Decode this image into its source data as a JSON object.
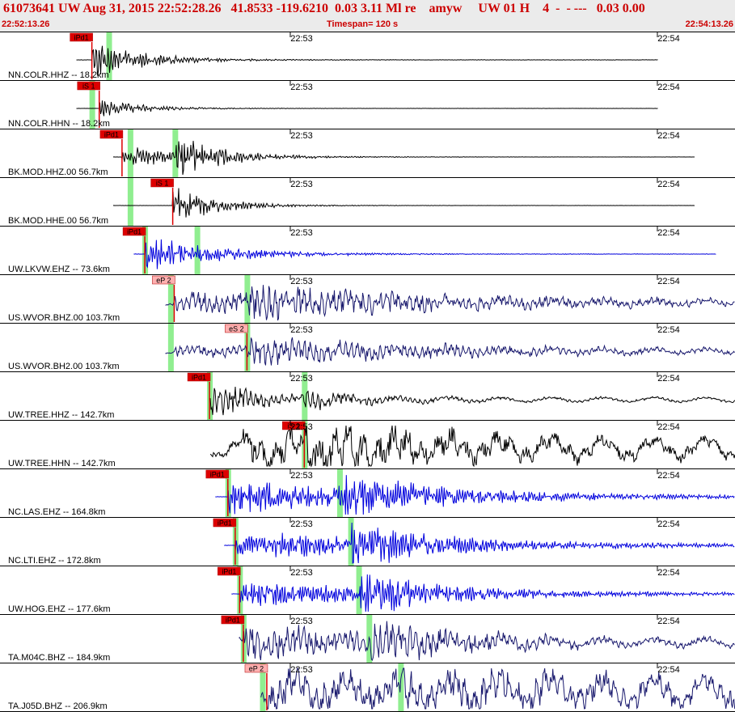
{
  "header": {
    "title": "61073641 UW Aug 31, 2015 22:52:28.26   41.8533 -119.6210  0.03 3.11 Ml re    amyw     UW 01 H    4  -  - ---   0.03 0.00",
    "start_time": "22:52:13.26",
    "timespan": "Timespan= 120 s",
    "end_time": "22:54:13.26"
  },
  "time_ticks": [
    "22:53",
    "22:54"
  ],
  "colors": {
    "black_trace": "#000000",
    "blue_trace": "#0000dd",
    "navy_trace": "#1a1a6e",
    "pick_red": "#dd0000",
    "pick_pale": "#ffb0b0",
    "green_window": "#90ee90"
  },
  "traces": [
    {
      "label": "NN.COLR.HHZ -- 18.2km",
      "color": "black",
      "start": 0.104,
      "end": 0.896,
      "onset": 0.125,
      "amp": 1.0,
      "decay": 0.07,
      "noise": 0.01,
      "period": 0.004,
      "second": null,
      "phase": "P",
      "pick": "iPd1",
      "pick_pos": 0.125,
      "green": [
        0.148
      ]
    },
    {
      "label": "NN.COLR.HHN -- 18.2km",
      "color": "black",
      "start": 0.104,
      "end": 0.896,
      "onset": 0.135,
      "amp": 0.5,
      "decay": 0.06,
      "noise": 0.005,
      "period": 0.004,
      "second": null,
      "phase": "S",
      "pick": "iS 1",
      "pick_pos": 0.135,
      "green": [
        0.125
      ]
    },
    {
      "label": "BK.MOD.HHZ.00 56.7km",
      "color": "black",
      "start": 0.154,
      "end": 0.946,
      "onset": 0.166,
      "amp": 0.55,
      "decay": 0.1,
      "noise": 0.005,
      "period": 0.004,
      "second": {
        "at": 0.238,
        "amp": 1.0,
        "decay": 0.05
      },
      "phase": "P",
      "pick": "iPd1",
      "pick_pos": 0.166,
      "green": [
        0.177,
        0.238
      ]
    },
    {
      "label": "BK.MOD.HHE.00 56.7km",
      "color": "black",
      "start": 0.154,
      "end": 0.946,
      "onset": 0.235,
      "amp": 1.0,
      "decay": 0.06,
      "noise": 0.005,
      "period": 0.004,
      "second": null,
      "phase": "S",
      "pick": "iS 1",
      "pick_pos": 0.235,
      "green": [
        0.177
      ]
    },
    {
      "label": "UW.LKVW.EHZ -- 73.6km",
      "color": "blue",
      "start": 0.182,
      "end": 0.975,
      "onset": 0.197,
      "amp": 1.0,
      "decay": 0.1,
      "noise": 0.01,
      "period": 0.0035,
      "second": null,
      "phase": "P",
      "pick": "iPd1",
      "pick_pos": 0.197,
      "green": [
        0.197,
        0.268
      ]
    },
    {
      "label": "US.WVOR.BHZ.00 103.7km",
      "color": "navy",
      "start": 0.225,
      "end": 1.0,
      "onset": 0.237,
      "amp": 0.55,
      "decay": 0.35,
      "noise": 0.06,
      "period": 0.008,
      "second": {
        "at": 0.336,
        "amp": 0.55,
        "decay": 0.25
      },
      "phase": "P",
      "pick": "eP 2",
      "pick_pos": 0.237,
      "green": [
        0.232,
        0.336
      ]
    },
    {
      "label": "US.WVOR.BH2.00 103.7km",
      "color": "navy",
      "start": 0.225,
      "end": 1.0,
      "onset": 0.237,
      "amp": 0.25,
      "decay": 0.3,
      "noise": 0.06,
      "period": 0.008,
      "second": {
        "at": 0.336,
        "amp": 0.55,
        "decay": 0.25
      },
      "phase": "S",
      "pick": "eS 2",
      "pick_pos": 0.336,
      "green": [
        0.232,
        0.336
      ]
    },
    {
      "label": "UW.TREE.HHZ -- 142.7km",
      "color": "black",
      "start": 0.286,
      "end": 1.0,
      "onset": 0.285,
      "amp": 0.9,
      "decay": 0.07,
      "noise": 0.06,
      "period": 0.007,
      "second": {
        "at": 0.414,
        "amp": 0.3,
        "decay": 0.1
      },
      "phase": "P",
      "pick": "iPd1",
      "pick_pos": 0.285,
      "green": [
        0.285,
        0.414
      ]
    },
    {
      "label": "UW.TREE.HHN -- 142.7km",
      "color": "black",
      "start": 0.286,
      "end": 1.0,
      "onset": 0.33,
      "amp": 0.7,
      "decay": 0.3,
      "noise": 0.25,
      "period": 0.02,
      "second": {
        "at": 0.414,
        "amp": 1.0,
        "decay": 0.12
      },
      "phase": "S",
      "pick": "iS 1",
      "pick_pos": 0.414,
      "green": [
        0.414
      ]
    },
    {
      "label": "NC.LAS.EHZ -- 164.8km",
      "color": "blue",
      "start": 0.293,
      "end": 1.0,
      "onset": 0.31,
      "amp": 0.9,
      "decay": 0.3,
      "noise": 0.01,
      "period": 0.0035,
      "second": {
        "at": 0.462,
        "amp": 1.0,
        "decay": 0.08
      },
      "phase": "P",
      "pick": "iPd1",
      "pick_pos": 0.31,
      "green": [
        0.31,
        0.462
      ]
    },
    {
      "label": "NC.LTI.EHZ -- 172.8km",
      "color": "blue",
      "start": 0.305,
      "end": 1.0,
      "onset": 0.32,
      "amp": 0.75,
      "decay": 0.3,
      "noise": 0.01,
      "period": 0.0035,
      "second": {
        "at": 0.477,
        "amp": 0.8,
        "decay": 0.1
      },
      "phase": "P",
      "pick": "iPd1",
      "pick_pos": 0.32,
      "green": [
        0.32,
        0.477
      ]
    },
    {
      "label": "UW.HOG.EHZ -- 177.6km",
      "color": "blue",
      "start": 0.315,
      "end": 1.0,
      "onset": 0.326,
      "amp": 0.65,
      "decay": 0.3,
      "noise": 0.01,
      "period": 0.0035,
      "second": {
        "at": 0.488,
        "amp": 1.0,
        "decay": 0.08
      },
      "phase": "P",
      "pick": "iPd1",
      "pick_pos": 0.326,
      "green": [
        0.326,
        0.488
      ]
    },
    {
      "label": "TA.M04C.BHZ -- 184.9km",
      "color": "navy",
      "start": 0.325,
      "end": 1.0,
      "onset": 0.331,
      "amp": 0.9,
      "decay": 0.2,
      "noise": 0.1,
      "period": 0.008,
      "second": {
        "at": 0.502,
        "amp": 0.7,
        "decay": 0.12
      },
      "phase": "P",
      "pick": "iPd1",
      "pick_pos": 0.331,
      "green": [
        0.331,
        0.502
      ]
    },
    {
      "label": "TA.J05D.BHZ -- 206.9km",
      "color": "navy",
      "start": 0.355,
      "end": 1.0,
      "onset": 0.363,
      "amp": 0.7,
      "decay": 0.35,
      "noise": 0.3,
      "period": 0.012,
      "second": {
        "at": 0.545,
        "amp": 0.5,
        "decay": 0.3
      },
      "phase": "P",
      "pick": "eP 2",
      "pick_pos": 0.363,
      "green": [
        0.357,
        0.545
      ]
    }
  ]
}
